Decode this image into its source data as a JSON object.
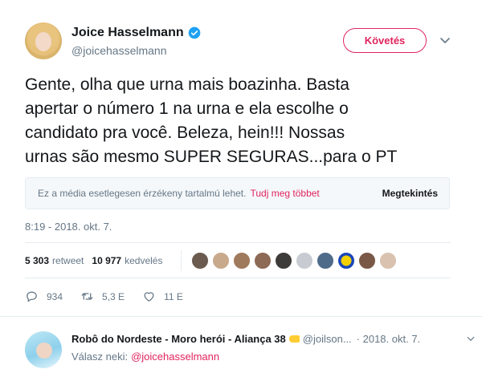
{
  "author": {
    "name": "Joice Hasselmann",
    "handle": "@joicehasselmann",
    "follow_label": "Követés"
  },
  "tweet": {
    "text": "Gente, olha que urna mais boazinha. Basta\napertar o número 1 na urna e ela escolhe o\ncandidato pra você. Beleza, hein!!! Nossas\nurnas são mesmo SUPER SEGURAS...para o PT",
    "timestamp": "8:19 - 2018. okt. 7."
  },
  "sensitive_media": {
    "notice": "Ez a média esetlegesen érzékeny tartalmú lehet.",
    "learn_more": "Tudj meg többet",
    "view_label": "Megtekintés"
  },
  "stats": {
    "retweets_count": "5 303",
    "retweets_label": "retweet",
    "likes_count": "10 977",
    "likes_label": "kedvelés"
  },
  "actions": {
    "replies": "934",
    "retweets": "5,3 E",
    "likes": "11 E"
  },
  "reply": {
    "name": "Robô do Nordeste - Moro herói - Aliança 38",
    "handle": "@joilson...",
    "date": "· 2018. okt. 7.",
    "reply_to_label": "Válasz neki:",
    "reply_to_handle": "@joicehasselmann"
  },
  "colors": {
    "accent": "#e0245e",
    "verified": "#1da1f2",
    "muted": "#657786"
  }
}
